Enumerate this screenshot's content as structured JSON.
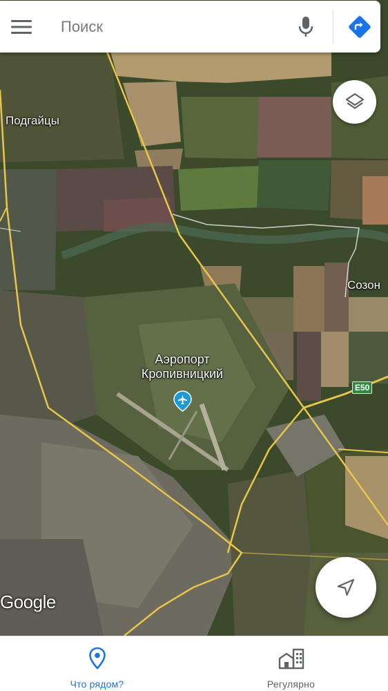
{
  "search": {
    "placeholder": "Поиск"
  },
  "map": {
    "labels": {
      "village_west": "Подгайцы",
      "village_east": "Созон",
      "airport_line1": "Аэропорт",
      "airport_line2": "Кропивницкий"
    },
    "road_badge": "E50",
    "attribution": "Google",
    "view": "satellite"
  },
  "bottom_nav": {
    "tabs": [
      {
        "label": "Что рядом?",
        "icon": "location-pin-icon",
        "active": true
      },
      {
        "label": "Регулярно",
        "icon": "buildings-icon",
        "active": false
      }
    ]
  },
  "colors": {
    "accent": "#1a73e8",
    "directions": "#1a73e8",
    "road_yellow": "#e8c64a",
    "airport_pin": "#1a9bd9"
  }
}
